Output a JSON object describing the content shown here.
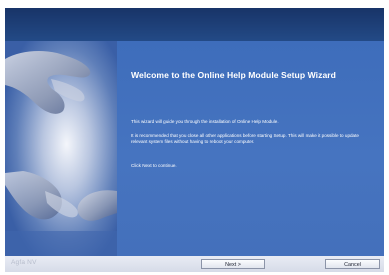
{
  "wizard": {
    "title": "Welcome to the Online Help Module Setup Wizard",
    "paragraphs": [
      "This wizard will guide you through the installation of Online Help Module.",
      "It is recommended that you close all other applications before starting Setup. This will make it possible to update relevant system files without having to reboot your computer.",
      "Click Next to continue."
    ]
  },
  "footer": {
    "brand": "Agfa NV",
    "next_label": "Next >",
    "cancel_label": "Cancel"
  },
  "colors": {
    "header": "#1d3c74",
    "panel": "#4270bb",
    "footer": "#dfe3ee",
    "title_text": "#ffffff"
  },
  "icons": {
    "side_image": "hand-image"
  }
}
